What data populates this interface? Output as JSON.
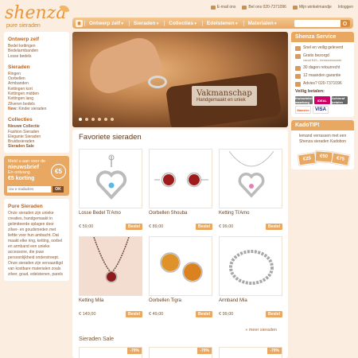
{
  "brand": {
    "name": "shenza",
    "tagline": "pure sieraden"
  },
  "toplinks": [
    {
      "icon": "email-icon",
      "label": "E-mail ons"
    },
    {
      "icon": "phone-icon",
      "label": "Bel ons 020-7371096"
    },
    {
      "icon": "cart-icon",
      "label": "Mijn winkelmandje"
    },
    {
      "icon": "",
      "label": "Inloggen"
    }
  ],
  "nav": {
    "items": [
      "Ontwerp zelf",
      "Sieraden",
      "Collecties",
      "Edelstenen",
      "Materialen"
    ],
    "search_placeholder": ""
  },
  "sidebar": {
    "sections": [
      {
        "heading": "Ontwerp zelf",
        "links": [
          "Bedel kettingen",
          "Bedelarmbanden",
          "Losse bedels"
        ]
      },
      {
        "heading": "Sieraden",
        "links": [
          "Ringen",
          "Oorbellen",
          "Armbanden",
          "Kettingen kort",
          "Kettingen midden",
          "Kettingen lang",
          "Zilveren bedels"
        ],
        "new_prefix": "New:",
        "new_link": "Kinder sieraden"
      },
      {
        "heading": "Collecties",
        "links": [
          "Nieuwe Collectie",
          "Fashion Sieraden",
          "Elegante Sieraden",
          "Bruidssieraden",
          "Sieraden Sale"
        ]
      }
    ]
  },
  "newsletter": {
    "line1": "Meld u aan voor de",
    "line2": "nieuwsbrief",
    "line3": "En ontvang",
    "line4": "€5 korting",
    "badge": "€5",
    "input_placeholder": "Uw e-mailadres",
    "ok_label": "OK"
  },
  "pure": {
    "heading": "Pure Sieraden",
    "text": "Onze sieraden zijn unieke creaties, handgemaakt in gelimiteerde oplagen door zilver- en goudsmeden met liefde voor hun ambacht. Dat maakt elke ring, ketting, oorbel en armband een unieke accessoire, die jouw persoonlijkheid onderstreept. Onze sieraden zijn vervaardigd van kostbare materialen zoals zilver, goud, edelstenen, parels"
  },
  "hero": {
    "title": "Vakmanschap",
    "subtitle": "Handgemaakt en uniek"
  },
  "favorites": {
    "title": "Favoriete sieraden",
    "products": [
      {
        "name": "Losse Bedel Ti'Amo",
        "price": "€ 59,00",
        "button": "Bestel",
        "image": "heart-pendant-blue"
      },
      {
        "name": "Oorbellen Shouba",
        "price": "€ 89,00",
        "button": "Bestel",
        "image": "red-stud-earrings"
      },
      {
        "name": "Ketting Ti'Amo",
        "price": "€ 99,00",
        "button": "Bestel",
        "image": "heart-necklace-pink"
      },
      {
        "name": "Ketting Mila",
        "price": "€ 149,00",
        "button": "Bestel",
        "image": "bead-necklace-red"
      },
      {
        "name": "Oorbellen Tigra",
        "price": "€ 49,00",
        "button": "Bestel",
        "image": "amber-earrings"
      },
      {
        "name": "Armband Mia",
        "price": "€ 99,00",
        "button": "Bestel",
        "image": "silver-chain-bracelet"
      }
    ],
    "more_link": "» meer sieraden",
    "sale_title": "Sieraden Sale",
    "sale_badges": [
      "-70%",
      "-70%",
      "-70%"
    ]
  },
  "service": {
    "heading": "Shenza Service",
    "items": [
      {
        "icon": "truck-icon",
        "text": "Snel en veilig geleverd",
        "sub": ""
      },
      {
        "icon": "gift-icon",
        "text": "Gratis bezorgd",
        "sub": "vanaf €45,- besteedwaarde"
      },
      {
        "icon": "return-icon",
        "text": "30 dagen retourrecht",
        "sub": ""
      },
      {
        "icon": "calendar-icon",
        "text": "12 maanden garantie",
        "sub": ""
      },
      {
        "icon": "phone-icon",
        "text": "Advies? 020-7371096",
        "sub": ""
      }
    ],
    "payment_heading": "Veilig betalen:",
    "payment_methods": [
      "thuiswinkel waarborg",
      "iDEAL",
      "Achteraf betalen",
      "Maestro",
      "VISA"
    ]
  },
  "kado": {
    "heading": "KadoTIP!",
    "text": "Iemand verrassen met een Shenza sieraden Kadobon",
    "cards": [
      "€25",
      "€50",
      "€75"
    ]
  },
  "colors": {
    "accent": "#e9a862",
    "brand": "#e8963b",
    "background": "#fbeee0"
  }
}
